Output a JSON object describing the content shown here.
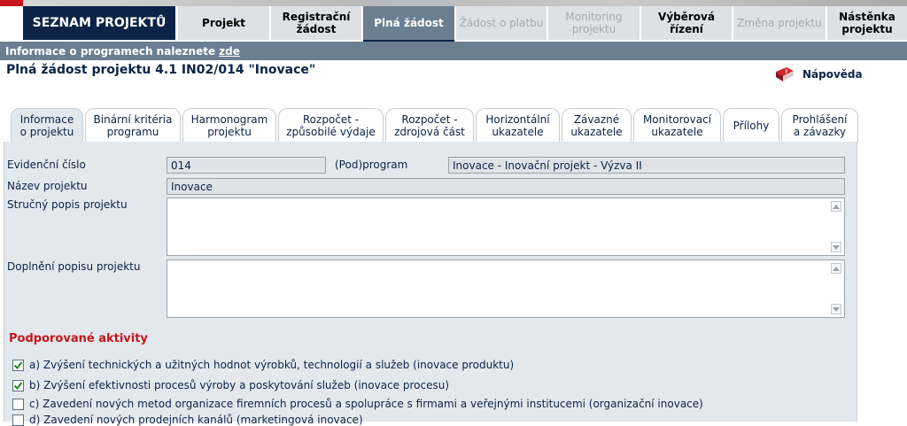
{
  "header": {
    "brand": "SEZNAM PROJEKTŮ",
    "tabs": [
      {
        "label": "Projekt",
        "state": "normal"
      },
      {
        "label": "Registrační\nžádost",
        "state": "normal"
      },
      {
        "label": "Plná žádost",
        "state": "active"
      },
      {
        "label": "Žádost o platbu",
        "state": "disabled"
      },
      {
        "label": "Monitoring\nprojektu",
        "state": "disabled"
      },
      {
        "label": "Výběrová řízení",
        "state": "normal"
      },
      {
        "label": "Změna projektu",
        "state": "disabled"
      },
      {
        "label": "Nástěnka\nprojektu",
        "state": "normal"
      }
    ]
  },
  "infobar": {
    "text": "Informace o programech naleznete",
    "link": "zde"
  },
  "page": {
    "title": "Plná žádost projektu  4.1 IN02/014 \"Inovace\"",
    "help_label": "Nápověda"
  },
  "tabs": [
    {
      "label": "Informace\no projektu",
      "active": true
    },
    {
      "label": "Binární kritéria\nprogramu",
      "active": false
    },
    {
      "label": "Harmonogram\nprojektu",
      "active": false
    },
    {
      "label": "Rozpočet -\nzpůsobilé výdaje",
      "active": false
    },
    {
      "label": "Rozpočet -\nzdrojová část",
      "active": false
    },
    {
      "label": "Horizontální\nukazatele",
      "active": false
    },
    {
      "label": "Závazné\nukazatele",
      "active": false
    },
    {
      "label": "Monitorovací\nukazatele",
      "active": false
    },
    {
      "label": "Přílohy",
      "active": false
    },
    {
      "label": "Prohlášení\na závazky",
      "active": false
    }
  ],
  "form": {
    "evidencni_cislo": {
      "label": "Evidenční číslo",
      "value": "014"
    },
    "podprogram": {
      "label": "(Pod)program",
      "value": "Inovace - Inovační projekt - Výzva II"
    },
    "nazev": {
      "label": "Název projektu",
      "value": "Inovace"
    },
    "strucny_popis": {
      "label": "Stručný popis projektu",
      "value": ""
    },
    "doplneni_popisu": {
      "label": "Doplnění popisu projektu",
      "value": ""
    }
  },
  "activities": {
    "title": "Podporované aktivity",
    "items": [
      {
        "label": "a) Zvýšení technických a užitných hodnot výrobků, technologií a služeb (inovace produktu)",
        "checked": true
      },
      {
        "label": "b) Zvýšení efektivnosti procesů výroby a poskytování služeb (inovace procesu)",
        "checked": true
      },
      {
        "label": "c) Zavedení nových metod organizace firemních procesů a spolupráce s firmami a veřejnými institucemi (organizační inovace)",
        "checked": false
      },
      {
        "label": "d) Zavedení nových prodejních kanálů (marketingová inovace)",
        "checked": false
      }
    ]
  },
  "colors": {
    "navy": "#0b2347",
    "accent_red": "#c4161c",
    "slate": "#6b7f91",
    "panel": "#e3e8ed"
  }
}
